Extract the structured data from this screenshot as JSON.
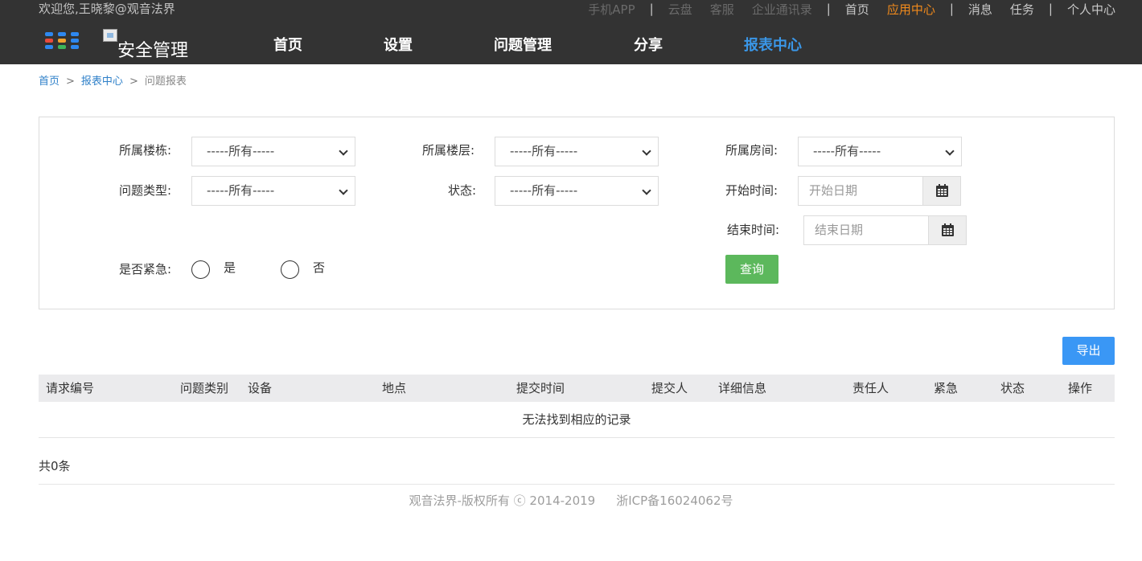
{
  "topbar": {
    "welcome": "欢迎您,王晓黎@观音法界",
    "links": {
      "mobile_app": "手机APP",
      "cloud_disk": "云盘",
      "service": "客服",
      "contacts": "企业通讯录",
      "home": "首页",
      "app_center": "应用中心",
      "messages": "消息",
      "tasks": "任务",
      "personal_center": "个人中心"
    },
    "separator": "|"
  },
  "navbar": {
    "brand": "安全管理",
    "items": {
      "home": "首页",
      "settings": "设置",
      "issue_management": "问题管理",
      "share": "分享",
      "report_center": "报表中心"
    },
    "active_item": "report_center",
    "colors": {
      "background": "#333333",
      "active": "#3a97e8",
      "highlight_link": "#f08a1c"
    }
  },
  "breadcrumb": {
    "home": "首页",
    "report_center": "报表中心",
    "current": "问题报表",
    "separator": ">"
  },
  "filters": {
    "building": {
      "label": "所属楼栋:",
      "value": "-----所有-----"
    },
    "floor": {
      "label": "所属楼层:",
      "value": "-----所有-----"
    },
    "room": {
      "label": "所属房间:",
      "value": "-----所有-----"
    },
    "issue_type": {
      "label": "问题类型:",
      "value": "-----所有-----"
    },
    "status": {
      "label": "状态:",
      "value": "-----所有-----"
    },
    "start_time": {
      "label": "开始时间:",
      "placeholder": "开始日期"
    },
    "end_time": {
      "label": "结束时间:",
      "placeholder": "结束日期"
    },
    "urgent": {
      "label": "是否紧急:",
      "options": {
        "yes": "是",
        "no": "否"
      }
    },
    "query_button": "查询"
  },
  "export_button": "导出",
  "table": {
    "columns": [
      "请求编号",
      "问题类别",
      "设备",
      "地点",
      "提交时间",
      "提交人",
      "详细信息",
      "责任人",
      "紧急",
      "状态",
      "操作"
    ],
    "empty_message": "无法找到相应的记录"
  },
  "total": "共0条",
  "footer": {
    "copyright": "观音法界-版权所有 ⓒ 2014-2019",
    "icp": "浙ICP备16024062号"
  },
  "colors": {
    "query_button": "#5cb85c",
    "export_button": "#3a97f5",
    "link": "#2f80c9"
  }
}
